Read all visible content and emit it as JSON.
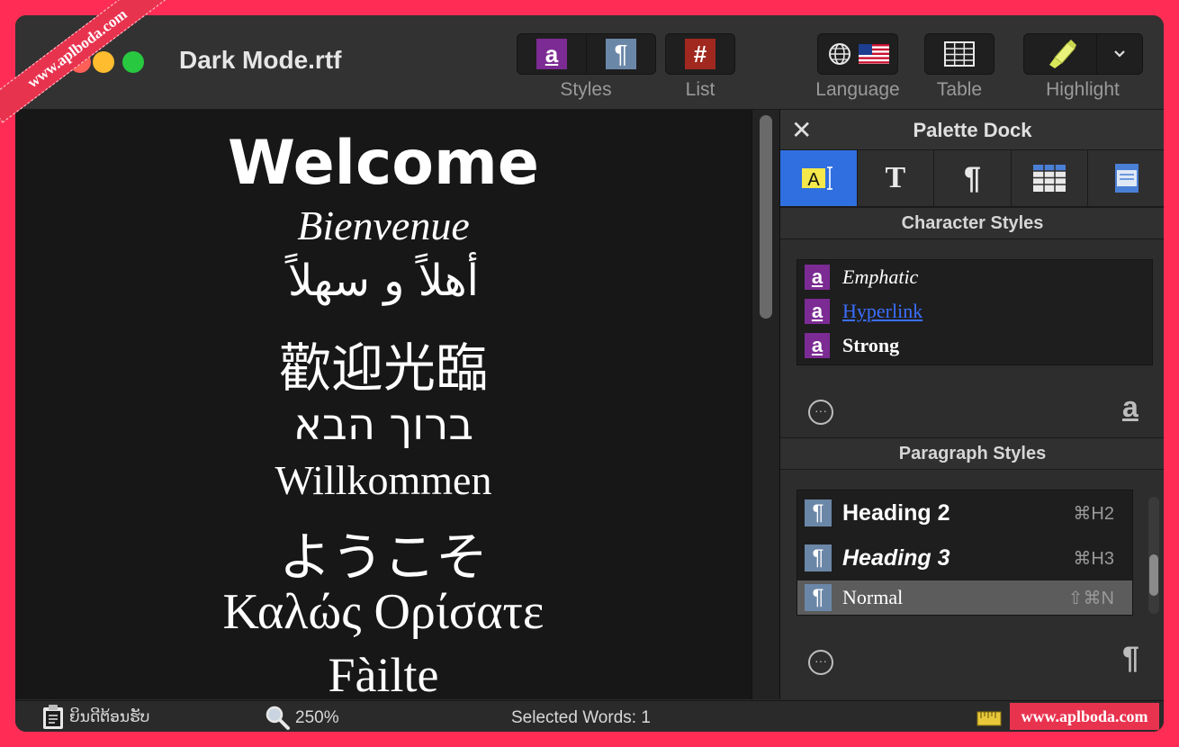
{
  "window": {
    "title": "Dark Mode.rtf"
  },
  "toolbar": {
    "styles_label": "Styles",
    "list_label": "List",
    "language_label": "Language",
    "table_label": "Table",
    "highlight_label": "Highlight",
    "style_char_glyph": "a",
    "style_para_glyph": "¶",
    "list_glyph": "#"
  },
  "document": {
    "lines": [
      "Welcome",
      "Bienvenue",
      "أهلاً و سهلاً",
      "歡迎光臨",
      "ברוך הבא",
      "Willkommen",
      "ようこそ",
      "Καλώς Ορίσατε",
      "Fàilte"
    ]
  },
  "dock": {
    "title": "Palette Dock",
    "close_glyph": "✕",
    "tab_text_glyph": "T",
    "tab_para_glyph": "¶",
    "char_section": "Character Styles",
    "char_styles": [
      {
        "name": "Emphatic",
        "glyph": "a"
      },
      {
        "name": "Hyperlink",
        "glyph": "a"
      },
      {
        "name": "Strong",
        "glyph": "a"
      }
    ],
    "char_more_glyph": "···",
    "char_add_glyph": "a",
    "para_section": "Paragraph Styles",
    "para_styles": [
      {
        "name": "Heading 2",
        "shortcut": "⌘H2",
        "glyph": "¶"
      },
      {
        "name": "Heading 3",
        "shortcut": "⌘H3",
        "glyph": "¶"
      },
      {
        "name": "Normal",
        "shortcut": "⇧⌘N",
        "glyph": "¶"
      }
    ],
    "para_more_glyph": "···",
    "para_add_glyph": "¶"
  },
  "status": {
    "lao_text": "ຍິນດີຕ້ອນຮັບ",
    "zoom": "250%",
    "selected_words": "Selected Words: 1"
  },
  "watermark": {
    "ribbon": "www.aplboda.com",
    "badge": "www.aplboda.com"
  },
  "colors": {
    "accent_blue": "#2f6fe0",
    "char_style_purple": "#7b2b93",
    "para_style_blue": "#6b87a8",
    "list_red": "#a0281f",
    "hyperlink": "#3b6fff"
  }
}
